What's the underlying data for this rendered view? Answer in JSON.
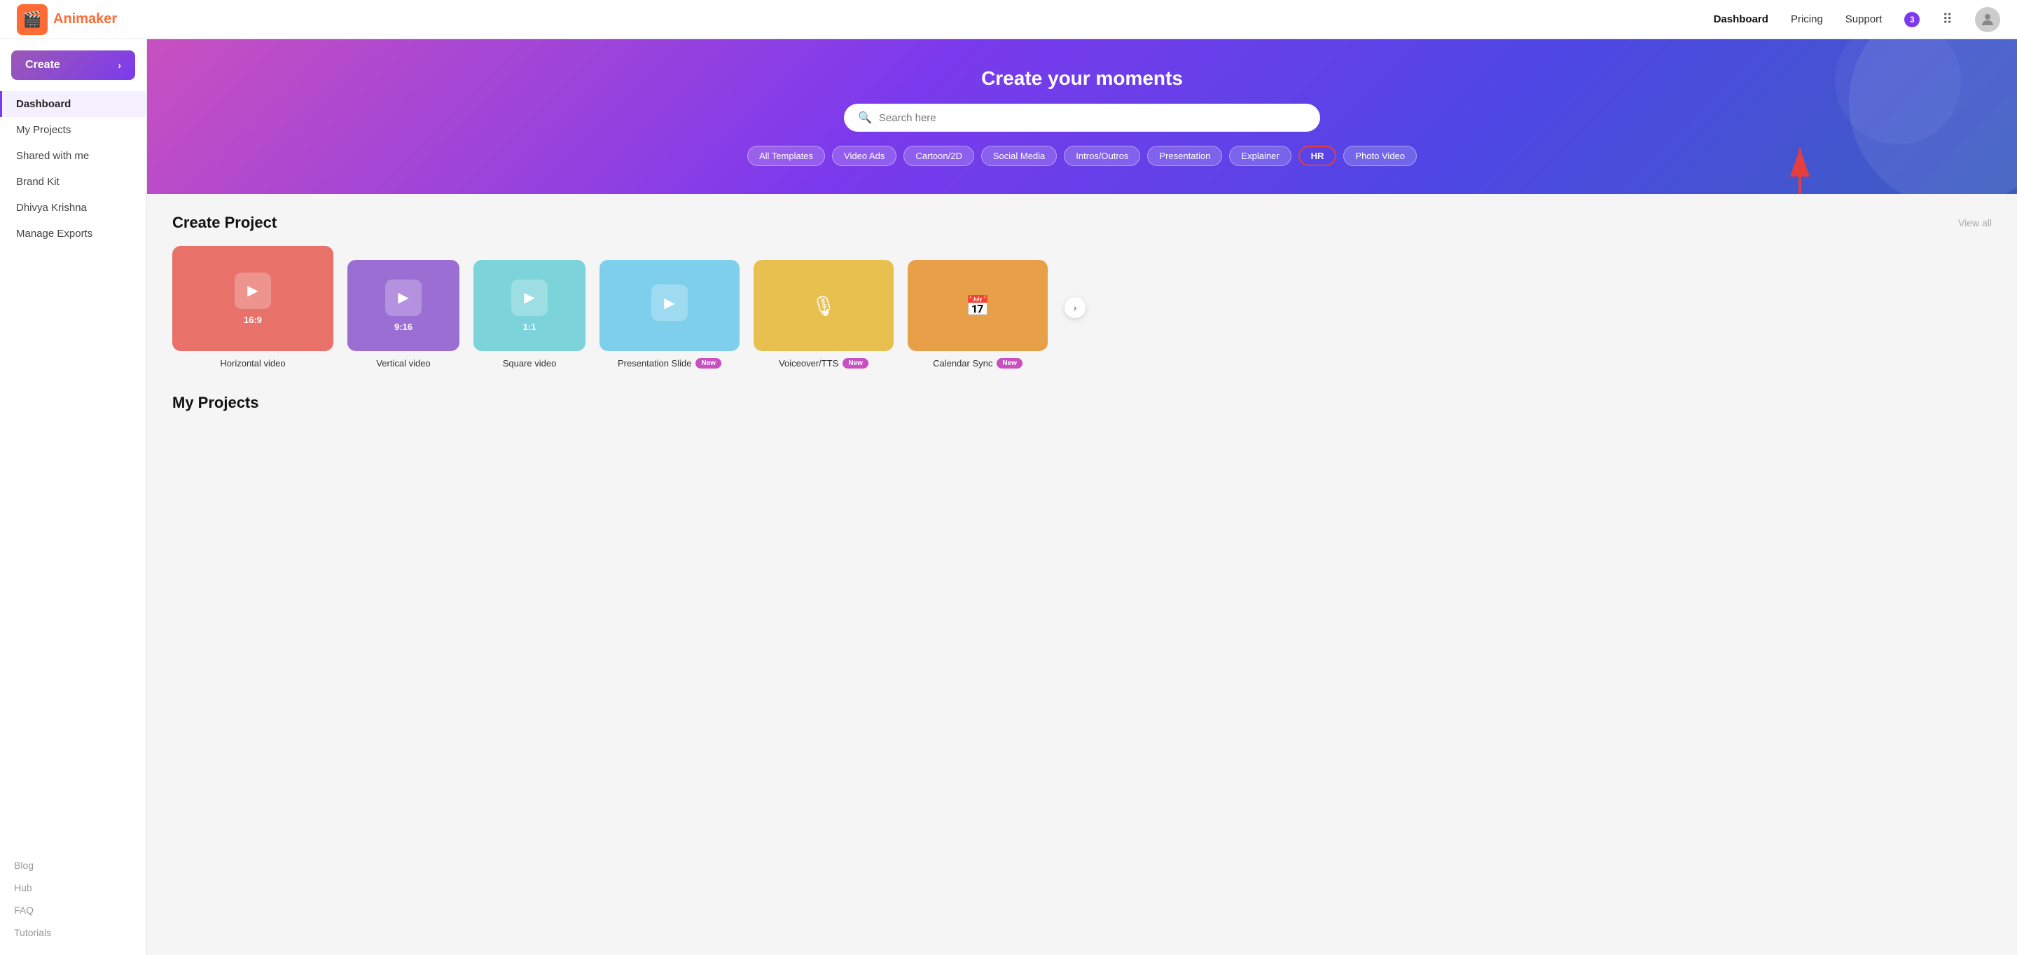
{
  "topnav": {
    "logo_emoji": "🎬",
    "logo_text": "Animaker",
    "links": [
      {
        "label": "Dashboard",
        "active": true
      },
      {
        "label": "Pricing",
        "active": false
      },
      {
        "label": "Support",
        "active": false
      }
    ],
    "notification_count": "3",
    "avatar_symbol": "👤"
  },
  "sidebar": {
    "create_label": "Create",
    "nav_items": [
      {
        "label": "Dashboard",
        "active": true
      },
      {
        "label": "My Projects",
        "active": false
      },
      {
        "label": "Shared with me",
        "active": false
      },
      {
        "label": "Brand Kit",
        "active": false
      },
      {
        "label": "Dhivya Krishna",
        "active": false
      },
      {
        "label": "Manage Exports",
        "active": false
      }
    ],
    "footer_items": [
      {
        "label": "Blog"
      },
      {
        "label": "Hub"
      },
      {
        "label": "FAQ"
      },
      {
        "label": "Tutorials"
      }
    ]
  },
  "hero": {
    "title": "Create your moments",
    "search_placeholder": "Search here",
    "tags": [
      {
        "label": "All Templates",
        "highlighted": false
      },
      {
        "label": "Video Ads",
        "highlighted": false
      },
      {
        "label": "Cartoon/2D",
        "highlighted": false
      },
      {
        "label": "Social Media",
        "highlighted": false
      },
      {
        "label": "Intros/Outros",
        "highlighted": false
      },
      {
        "label": "Presentation",
        "highlighted": false
      },
      {
        "label": "Explainer",
        "highlighted": false
      },
      {
        "label": "HR",
        "highlighted": true
      },
      {
        "label": "Photo Video",
        "highlighted": false
      }
    ]
  },
  "create_project": {
    "section_title": "Create Project",
    "view_all": "View all",
    "cards": [
      {
        "label": "Horizontal video",
        "ratio": "16:9",
        "type": "play",
        "color": "red",
        "new": false
      },
      {
        "label": "Vertical video",
        "ratio": "9:16",
        "type": "play",
        "color": "purple",
        "new": false
      },
      {
        "label": "Square video",
        "ratio": "1:1",
        "type": "play",
        "color": "teal",
        "new": false
      },
      {
        "label": "Presentation Slide",
        "ratio": "",
        "type": "play",
        "color": "sky",
        "new": true
      },
      {
        "label": "Voiceover/TTS",
        "ratio": "",
        "type": "wave",
        "color": "yellow",
        "new": true
      },
      {
        "label": "Calendar Sync",
        "ratio": "",
        "type": "calendar",
        "color": "orange",
        "new": true
      }
    ]
  },
  "my_projects": {
    "section_title": "My Projects"
  }
}
